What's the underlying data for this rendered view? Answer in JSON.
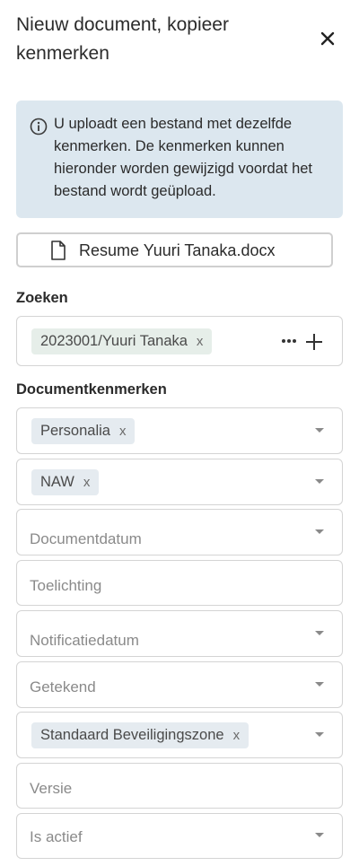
{
  "panel": {
    "title": "Nieuw document, kopieer kenmerken",
    "close_icon": "close-icon"
  },
  "info": {
    "icon": "info-icon",
    "text": "U uploadt een bestand met dezelfde kenmerken. De kenmerken kunnen hieronder worden gewijzigd voordat het bestand wordt geüpload."
  },
  "file": {
    "icon": "document-icon",
    "name": "Resume Yuuri Tanaka.docx"
  },
  "search": {
    "label": "Zoeken",
    "chip": "2023001/Yuuri Tanaka",
    "chip_remove": "x",
    "more_icon": "ellipsis-icon",
    "add_icon": "plus-icon"
  },
  "attributes": {
    "label": "Documentkenmerken",
    "category_chip": "Personalia",
    "category_remove": "x",
    "type_chip": "NAW",
    "type_remove": "x",
    "document_date": "Documentdatum",
    "note": "Toelichting",
    "notification_date": "Notificatiedatum",
    "signed": "Getekend",
    "zone_chip": "Standaard Beveiligingszone",
    "zone_remove": "x",
    "version": "Versie",
    "active": "Is actief"
  }
}
